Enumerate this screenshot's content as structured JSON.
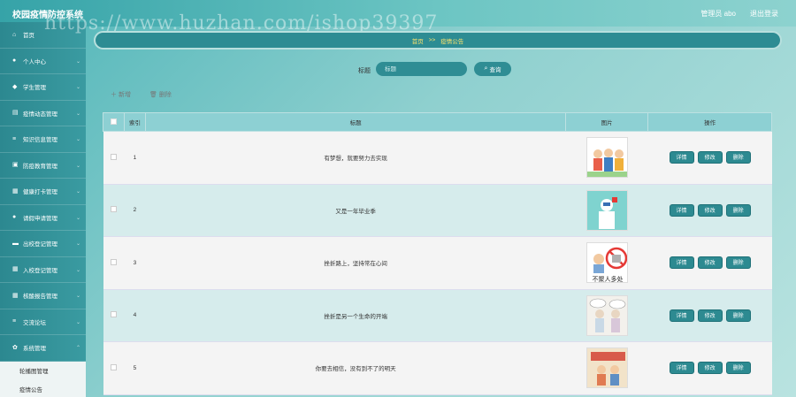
{
  "header": {
    "app_title": "校园疫情防控系统",
    "user": "管理员 abo",
    "logout": "退出登录",
    "watermark": "https://www.huzhan.com/ishop39397"
  },
  "sidebar": {
    "items": [
      {
        "label": "首页",
        "icon": "home-icon"
      },
      {
        "label": "个人中心",
        "icon": "user-icon"
      },
      {
        "label": "学生管理",
        "icon": "student-icon"
      },
      {
        "label": "疫情动态管理",
        "icon": "news-icon"
      },
      {
        "label": "知识信息管理",
        "icon": "list-icon"
      },
      {
        "label": "防疫教育管理",
        "icon": "book-icon"
      },
      {
        "label": "健康打卡管理",
        "icon": "grid-icon"
      },
      {
        "label": "请假申请管理",
        "icon": "user-icon"
      },
      {
        "label": "出校登记管理",
        "icon": "chat-icon"
      },
      {
        "label": "入校登记管理",
        "icon": "grid-icon"
      },
      {
        "label": "核酸报告管理",
        "icon": "grid-icon"
      },
      {
        "label": "交流论坛",
        "icon": "list-icon"
      },
      {
        "label": "系统管理",
        "icon": "settings-icon"
      }
    ],
    "sub_items": [
      "轮播图管理",
      "疫情公告"
    ]
  },
  "breadcrumb": {
    "home": "首页",
    "sep": ">>",
    "current": "疫情公告"
  },
  "search": {
    "label": "标题",
    "placeholder": "标题",
    "button": "查询"
  },
  "toolbar": {
    "add": "新增",
    "delete": "删除"
  },
  "table": {
    "headers": {
      "index": "索引",
      "title": "标题",
      "image": "图片",
      "actions": "操作"
    },
    "actions": {
      "detail": "详情",
      "edit": "修改",
      "delete": "删除"
    },
    "rows": [
      {
        "index": "1",
        "title": "有梦想，就要努力去实现"
      },
      {
        "index": "2",
        "title": "又是一年毕业季"
      },
      {
        "index": "3",
        "title": "挫折路上，坚持常在心间"
      },
      {
        "index": "4",
        "title": "挫折是另一个生命的开端"
      },
      {
        "index": "5",
        "title": "你要去相信，没有到不了的明天"
      }
    ]
  },
  "image_caption_3": "不聚人多处"
}
